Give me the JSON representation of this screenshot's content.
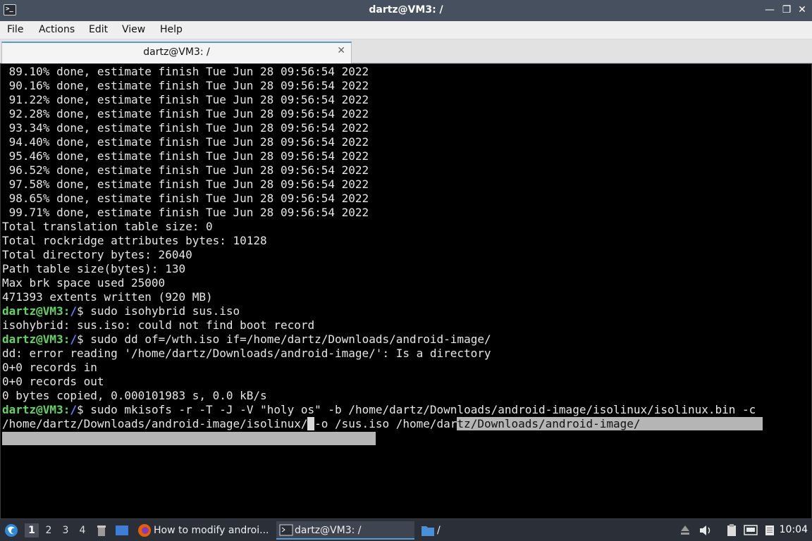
{
  "window": {
    "title": "dartz@VM3: /",
    "minimize_glyph": "—",
    "restore_glyph": "❐",
    "close_glyph": "✕"
  },
  "menu": {
    "file": "File",
    "actions": "Actions",
    "edit": "Edit",
    "view": "View",
    "help": "Help"
  },
  "tab": {
    "label": "dartz@VM3: /",
    "close_glyph": "✕"
  },
  "terminal": {
    "progress_lines": [
      " 89.10% done, estimate finish Tue Jun 28 09:56:54 2022",
      " 90.16% done, estimate finish Tue Jun 28 09:56:54 2022",
      " 91.22% done, estimate finish Tue Jun 28 09:56:54 2022",
      " 92.28% done, estimate finish Tue Jun 28 09:56:54 2022",
      " 93.34% done, estimate finish Tue Jun 28 09:56:54 2022",
      " 94.40% done, estimate finish Tue Jun 28 09:56:54 2022",
      " 95.46% done, estimate finish Tue Jun 28 09:56:54 2022",
      " 96.52% done, estimate finish Tue Jun 28 09:56:54 2022",
      " 97.58% done, estimate finish Tue Jun 28 09:56:54 2022",
      " 98.65% done, estimate finish Tue Jun 28 09:56:54 2022",
      " 99.71% done, estimate finish Tue Jun 28 09:56:54 2022"
    ],
    "summary_lines": [
      "Total translation table size: 0",
      "Total rockridge attributes bytes: 10128",
      "Total directory bytes: 26040",
      "Path table size(bytes): 130",
      "Max brk space used 25000",
      "471393 extents written (920 MB)"
    ],
    "prompt_user": "dartz@VM3",
    "prompt_colon": ":",
    "prompt_path": "/",
    "prompt_dollar": "$",
    "cmd1": " sudo isohybrid sus.iso",
    "out1": "isohybrid: sus.iso: could not find boot record",
    "cmd2": " sudo dd of=/wth.iso if=/home/dartz/Downloads/android-image/",
    "out2": [
      "dd: error reading '/home/dartz/Downloads/android-image/': Is a directory",
      "0+0 records in",
      "0+0 records out",
      "0 bytes copied, 0.000101983 s, 0.0 kB/s"
    ],
    "cmd3": " sudo mkisofs -r -T -J -V \"holy os\" -b /home/dartz/Downloads/android-image/isolinux/isolinux.bin -c",
    "cmd3_cont_a": "/home/dartz/Downloads/android-image/isolinux/",
    "cmd3_cont_cursor": " ",
    "cmd3_cont_b": "-o /sus.iso /home/dar",
    "cmd3_cont_tail": "tz/Downloads/android-image/",
    "cmd3_cont_pad": "                  "
  },
  "taskbar": {
    "workspaces": [
      "1",
      "2",
      "3",
      "4"
    ],
    "firefox_task": "How to modify androi...",
    "terminal_task": "dartz@VM3: /",
    "files_task": "/",
    "clock": "10:04"
  },
  "colors": {
    "terminal_bg": "#000000",
    "prompt_user": "#5fd75f",
    "prompt_path": "#5f87ff",
    "selection": "#b5b5b5"
  }
}
